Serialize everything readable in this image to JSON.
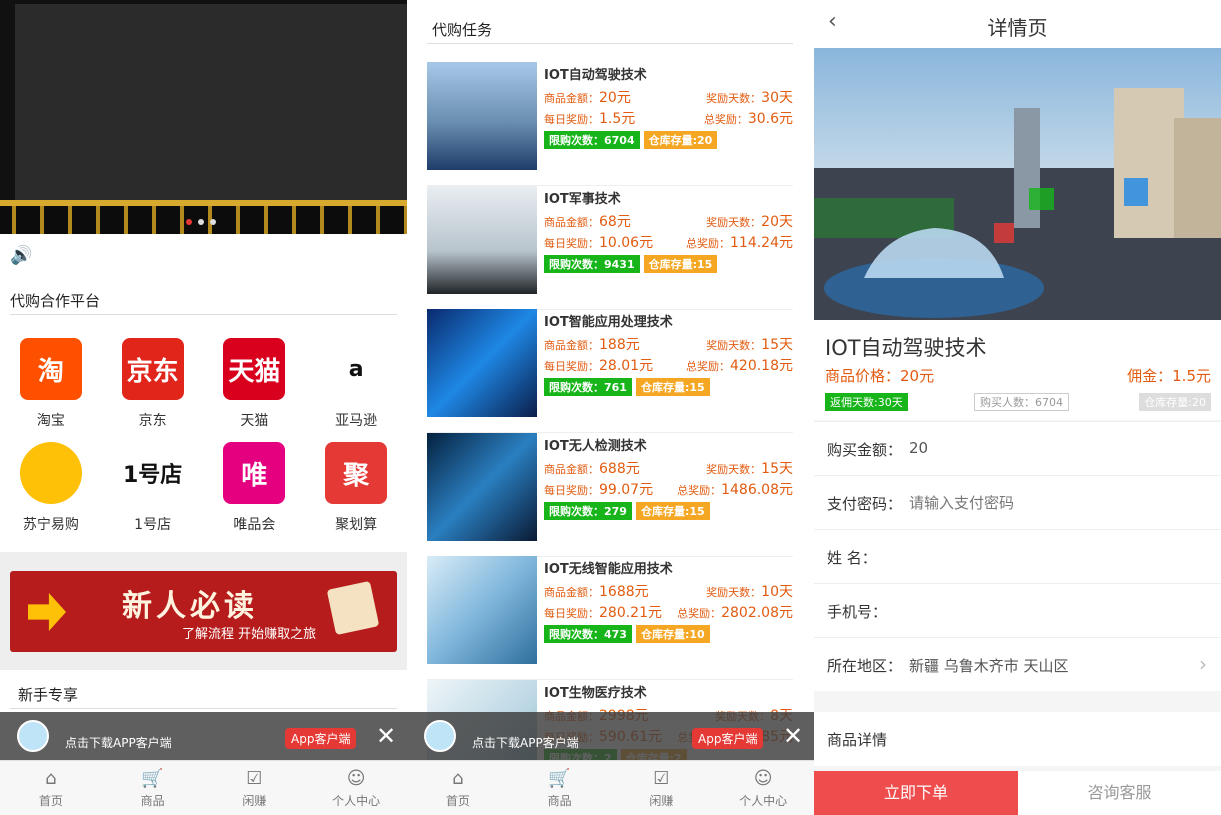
{
  "screen1": {
    "section_title": "代购合作平台",
    "platforms": [
      {
        "name": "淘宝",
        "logo_text": "淘",
        "color": "#ff5000"
      },
      {
        "name": "京东",
        "logo_text": "京东",
        "color": "#e1251b"
      },
      {
        "name": "天猫",
        "logo_text": "天猫",
        "color": "#d8001c"
      },
      {
        "name": "亚马逊",
        "logo_text": "a",
        "color": "#ffffff"
      },
      {
        "name": "苏宁易购",
        "logo_text": "",
        "color": "#ffc107"
      },
      {
        "name": "1号店",
        "logo_text": "1号店",
        "color": "#ffffff"
      },
      {
        "name": "唯品会",
        "logo_text": "唯",
        "color": "#e4007f"
      },
      {
        "name": "聚划算",
        "logo_text": "聚",
        "color": "#e53935"
      }
    ],
    "promo_title": "新人必读",
    "promo_subtitle": "了解流程 开始赚取之旅",
    "newbie_title": "新手专享"
  },
  "download_bar": {
    "text": "点击下载APP客户端",
    "button": "App客户端",
    "close": "✕"
  },
  "tabbar": [
    {
      "label": "首页",
      "icon": "home-icon",
      "glyph": "⌂"
    },
    {
      "label": "商品",
      "icon": "cart-icon",
      "glyph": "🛒"
    },
    {
      "label": "闲赚",
      "icon": "task-icon",
      "glyph": "☑"
    },
    {
      "label": "个人中心",
      "icon": "user-icon",
      "glyph": "☺"
    }
  ],
  "screen2": {
    "section_title": "代购任务",
    "labels": {
      "amount": "商品金额：",
      "days": "奖励天数：",
      "daily": "每日奖励：",
      "total": "总奖励："
    },
    "tasks": [
      {
        "title": "IOT自动驾驶技术",
        "amount": "20元",
        "days": "30天",
        "daily": "1.5元",
        "total": "30.6元",
        "limit": "限购次数：6704",
        "stock": "仓库存量:20",
        "thumb": "linear-gradient(180deg,#a8c8e8 0%,#6a8fb0 55%,#1f3d6b 100%)"
      },
      {
        "title": "IOT军事技术",
        "amount": "68元",
        "days": "20天",
        "daily": "10.06元",
        "total": "114.24元",
        "limit": "限购次数：9431",
        "stock": "仓库存量:15",
        "thumb": "linear-gradient(180deg,#e9eef2 0%,#b8c4cc 60%,#202428 100%)"
      },
      {
        "title": "IOT智能应用处理技术",
        "amount": "188元",
        "days": "15天",
        "daily": "28.01元",
        "total": "420.18元",
        "limit": "限购次数：761",
        "stock": "仓库存量:15",
        "thumb": "linear-gradient(135deg,#0a2a6e 0%,#1e88e5 50%,#0b1d4a 100%)"
      },
      {
        "title": "IOT无人检测技术",
        "amount": "688元",
        "days": "15天",
        "daily": "99.07元",
        "total": "1486.08元",
        "limit": "限购次数：279",
        "stock": "仓库存量:15",
        "thumb": "linear-gradient(135deg,#04213f 0%,#2a7fc1 50%,#0a1a33 100%)"
      },
      {
        "title": "IOT无线智能应用技术",
        "amount": "1688元",
        "days": "10天",
        "daily": "280.21元",
        "total": "2802.08元",
        "limit": "限购次数：473",
        "stock": "仓库存量:10",
        "thumb": "linear-gradient(135deg,#d9ecf7 0%,#7fb6dc 50%,#2f6f9c 100%)"
      },
      {
        "title": "IOT生物医疗技术",
        "amount": "2998元",
        "days": "8天",
        "daily": "590.61元",
        "total": "4724.85元",
        "limit": "限购次数：2",
        "stock": "仓库存量:2",
        "thumb": "linear-gradient(135deg,#eef5f8 0%,#b9d6e3 60%,#6aa0b8 100%)"
      }
    ]
  },
  "screen3": {
    "page_title": "详情页",
    "product_name": "IOT自动驾驶技术",
    "price": "商品价格：20元",
    "commission": "佣金：1.5元",
    "badge_days": "返佣天数:30天",
    "badge_buyers": "购买人数：6704",
    "badge_stock": "仓库存量:20",
    "fields": {
      "amount_label": "购买金额：",
      "amount_value": "20",
      "password_label": "支付密码：",
      "password_placeholder": "请输入支付密码",
      "name_label": "姓 名：",
      "phone_label": "手机号：",
      "region_label": "所在地区：",
      "region_value": "新疆 乌鲁木齐市 天山区"
    },
    "detail_title": "商品详情",
    "buy_button": "立即下单",
    "service_button": "咨询客服"
  }
}
